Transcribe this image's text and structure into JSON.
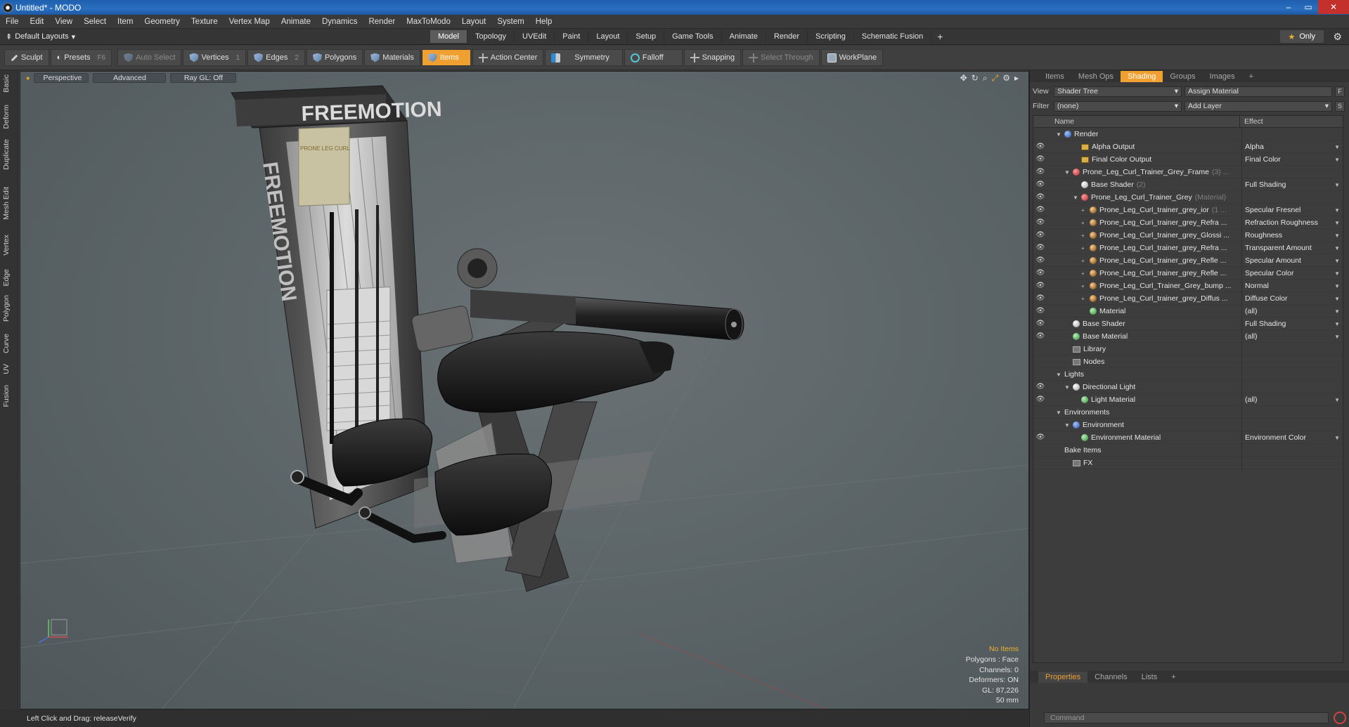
{
  "window": {
    "title": "Untitled* - MODO",
    "controls": [
      "–",
      "▭",
      "✕"
    ]
  },
  "menu": [
    "File",
    "Edit",
    "View",
    "Select",
    "Item",
    "Geometry",
    "Texture",
    "Vertex Map",
    "Animate",
    "Dynamics",
    "Render",
    "MaxToModo",
    "Layout",
    "System",
    "Help"
  ],
  "layout": {
    "label": "Default Layouts"
  },
  "tabs": [
    "Model",
    "Topology",
    "UVEdit",
    "Paint",
    "Layout",
    "Setup",
    "Game Tools",
    "Animate",
    "Render",
    "Scripting",
    "Schematic Fusion"
  ],
  "tabs_add": "+",
  "only_label": "Only",
  "toolbar": {
    "sculpt": "Sculpt",
    "presets": "Presets",
    "presets_key": "F6",
    "auto_select": "Auto Select",
    "vertices": "Vertices",
    "vertices_key": "1",
    "edges": "Edges",
    "edges_key": "2",
    "polygons": "Polygons",
    "materials": "Materials",
    "items": "Items",
    "action_center": "Action Center",
    "symmetry": "Symmetry",
    "falloff": "Falloff",
    "snapping": "Snapping",
    "select_through": "Select Through",
    "workplane": "WorkPlane"
  },
  "left_tabs": [
    "Basic",
    "Deform",
    "Duplicate",
    "Mesh Edit",
    "Vertex",
    "Edge",
    "Polygon",
    "Curve",
    "UV",
    "Fusion"
  ],
  "viewport": {
    "perspective": "Perspective",
    "advanced": "Advanced",
    "raygl": "Ray GL: Off",
    "brand": "FREEMOTION",
    "placard": "PRONE LEG CURL",
    "info": {
      "no_items": "No Items",
      "polygons": "Polygons : Face",
      "channels": "Channels: 0",
      "deformers": "Deformers: ON",
      "gl": "GL: 87,226",
      "scale": "50 mm"
    }
  },
  "status": {
    "text": "Left Click and Drag:  releaseVerify"
  },
  "right": {
    "tabs": [
      "Items",
      "Mesh Ops",
      "Shading",
      "Groups",
      "Images",
      "+"
    ],
    "view_label": "View",
    "view_value": "Shader Tree",
    "assign_material": "Assign Material",
    "filter_label": "Filter",
    "filter_value": "(none)",
    "add_layer": "Add Layer",
    "btn_f": "F",
    "btn_s": "S",
    "col_name": "Name",
    "col_effect": "Effect",
    "rows": [
      {
        "indent": 0,
        "tri": "▼",
        "icon": "dot blue",
        "name": "Render",
        "sub": "",
        "effect": "",
        "eye": false
      },
      {
        "indent": 2,
        "tri": "",
        "icon": "sq",
        "name": "Alpha Output",
        "sub": "",
        "effect": "Alpha",
        "eye": true
      },
      {
        "indent": 2,
        "tri": "",
        "icon": "sq",
        "name": "Final Color Output",
        "sub": "",
        "effect": "Final Color",
        "eye": true
      },
      {
        "indent": 1,
        "tri": "▼",
        "icon": "dot red",
        "name": "Prone_Leg_Curl_Trainer_Grey_Frame",
        "sub": "(3) ...",
        "effect": "",
        "eye": true
      },
      {
        "indent": 2,
        "tri": "",
        "icon": "dot white",
        "name": "Base Shader",
        "sub": "(2)",
        "effect": "Full Shading",
        "eye": true
      },
      {
        "indent": 2,
        "tri": "▼",
        "icon": "dot red",
        "name": "Prone_Leg_Curl_Trainer_Grey",
        "sub": "(Material)",
        "effect": "",
        "eye": true
      },
      {
        "indent": 3,
        "tri": "+",
        "icon": "dot orange",
        "name": "Prone_Leg_Curl_trainer_grey_ior",
        "sub": "(1 ...",
        "effect": "Specular Fresnel",
        "eye": true
      },
      {
        "indent": 3,
        "tri": "+",
        "icon": "dot orange",
        "name": "Prone_Leg_Curl_trainer_grey_Refra ...",
        "sub": "",
        "effect": "Refraction Roughness",
        "eye": true
      },
      {
        "indent": 3,
        "tri": "+",
        "icon": "dot orange",
        "name": "Prone_Leg_Curl_trainer_grey_Glossi ...",
        "sub": "",
        "effect": "Roughness",
        "eye": true
      },
      {
        "indent": 3,
        "tri": "+",
        "icon": "dot orange",
        "name": "Prone_Leg_Curl_trainer_grey_Refra ...",
        "sub": "",
        "effect": "Transparent Amount",
        "eye": true
      },
      {
        "indent": 3,
        "tri": "+",
        "icon": "dot orange",
        "name": "Prone_Leg_Curl_trainer_grey_Refle ...",
        "sub": "",
        "effect": "Specular Amount",
        "eye": true
      },
      {
        "indent": 3,
        "tri": "+",
        "icon": "dot orange",
        "name": "Prone_Leg_Curl_trainer_grey_Refle ...",
        "sub": "",
        "effect": "Specular Color",
        "eye": true
      },
      {
        "indent": 3,
        "tri": "+",
        "icon": "dot orange",
        "name": "Prone_Leg_Curl_Trainer_Grey_bump ...",
        "sub": "",
        "effect": "Normal",
        "eye": true
      },
      {
        "indent": 3,
        "tri": "+",
        "icon": "dot orange",
        "name": "Prone_Leg_Curl_trainer_grey_Diffus ...",
        "sub": "",
        "effect": "Diffuse Color",
        "eye": true
      },
      {
        "indent": 3,
        "tri": "",
        "icon": "dot green",
        "name": "Material",
        "sub": "",
        "effect": "(all)",
        "eye": true
      },
      {
        "indent": 1,
        "tri": "",
        "icon": "dot white",
        "name": "Base Shader",
        "sub": "",
        "effect": "Full Shading",
        "eye": true
      },
      {
        "indent": 1,
        "tri": "",
        "icon": "dot green",
        "name": "Base Material",
        "sub": "",
        "effect": "(all)",
        "eye": true
      },
      {
        "indent": 1,
        "tri": "",
        "icon": "folder",
        "name": "Library",
        "sub": "",
        "effect": "",
        "eye": false
      },
      {
        "indent": 1,
        "tri": "",
        "icon": "folder",
        "name": "Nodes",
        "sub": "",
        "effect": "",
        "eye": false
      },
      {
        "indent": 0,
        "tri": "▼",
        "icon": "",
        "name": "Lights",
        "sub": "",
        "effect": "",
        "eye": false
      },
      {
        "indent": 1,
        "tri": "▼",
        "icon": "dot white",
        "name": "Directional Light",
        "sub": "",
        "effect": "",
        "eye": true
      },
      {
        "indent": 2,
        "tri": "",
        "icon": "dot green",
        "name": "Light Material",
        "sub": "",
        "effect": "(all)",
        "eye": true
      },
      {
        "indent": 0,
        "tri": "▼",
        "icon": "",
        "name": "Environments",
        "sub": "",
        "effect": "",
        "eye": false
      },
      {
        "indent": 1,
        "tri": "▼",
        "icon": "dot blue",
        "name": "Environment",
        "sub": "",
        "effect": "",
        "eye": false
      },
      {
        "indent": 2,
        "tri": "",
        "icon": "dot green",
        "name": "Environment Material",
        "sub": "",
        "effect": "Environment Color",
        "eye": true
      },
      {
        "indent": 0,
        "tri": "",
        "icon": "",
        "name": "Bake Items",
        "sub": "",
        "effect": "",
        "eye": false
      },
      {
        "indent": 1,
        "tri": "",
        "icon": "folder",
        "name": "FX",
        "sub": "",
        "effect": "",
        "eye": false
      }
    ],
    "prop_tabs": [
      "Properties",
      "Channels",
      "Lists",
      "+"
    ],
    "command_placeholder": "Command"
  }
}
